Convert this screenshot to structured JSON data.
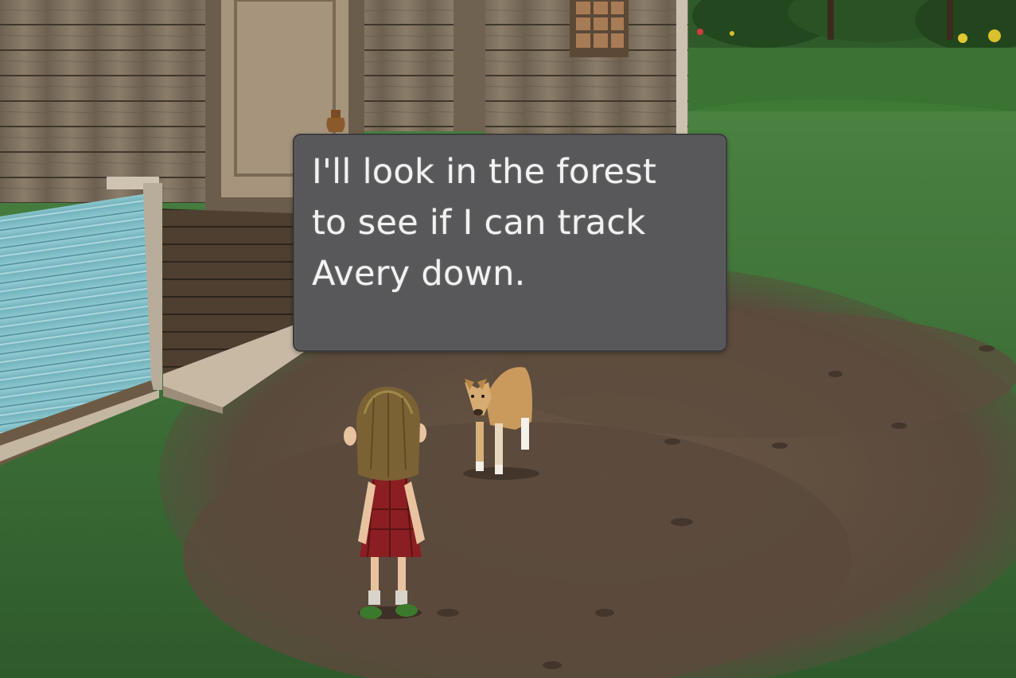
{
  "dialogue": {
    "text": "I'll look in the forest\nto see if I can track\nAvery down."
  },
  "colors": {
    "grass": "#3f6e3a",
    "dirt": "#5b4a3c",
    "wood": "#8a7a66",
    "tin": "#7fbcc4",
    "dialogue_bg": "#58585a",
    "dialogue_text": "#f2f2f2"
  }
}
